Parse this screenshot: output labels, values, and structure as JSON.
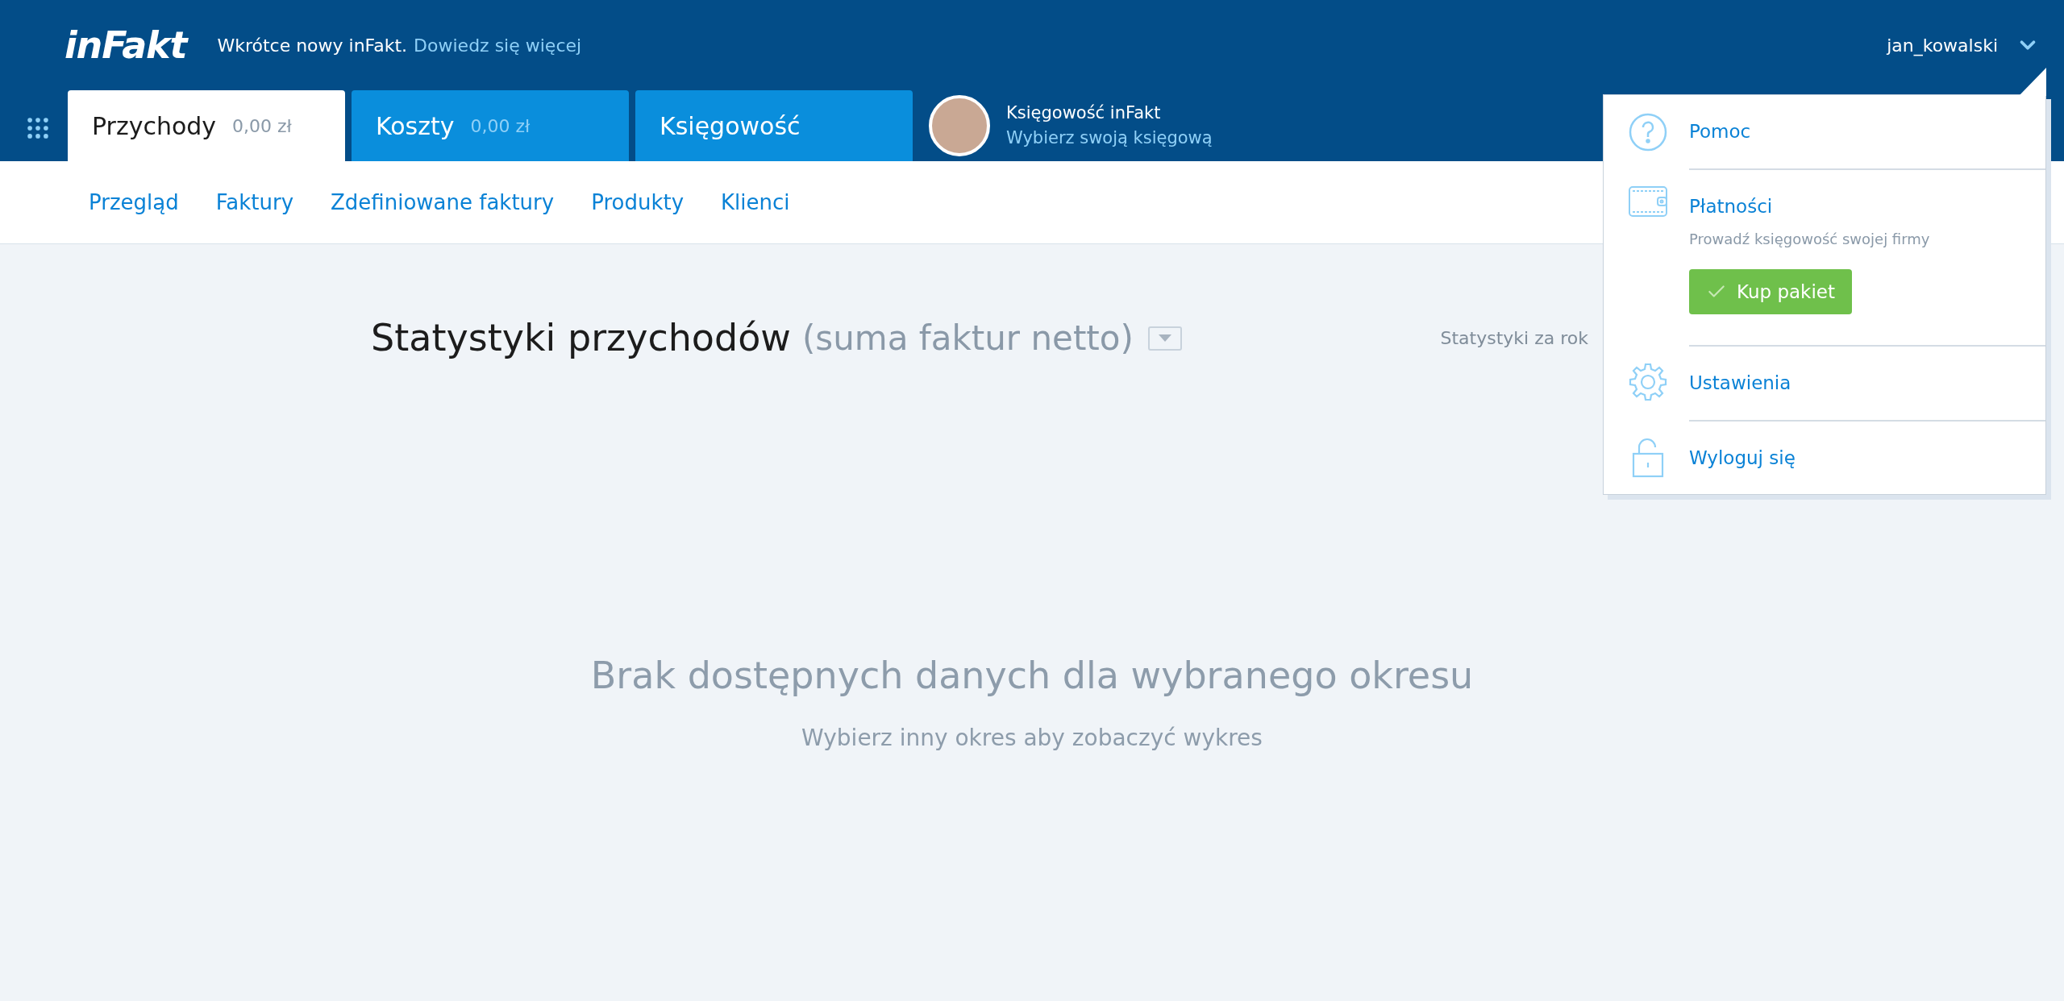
{
  "header": {
    "logo": "inFakt",
    "announcement": "Wkrótce nowy inFakt.",
    "announcement_link": "Dowiedz się więcej",
    "username": "jan_kowalski"
  },
  "tabs": [
    {
      "label": "Przychody",
      "amount": "0,00 zł",
      "selected": true
    },
    {
      "label": "Koszty",
      "amount": "0,00 zł",
      "selected": false
    },
    {
      "label": "Księgowość",
      "selected": false
    }
  ],
  "accountant": {
    "title": "Księgowość inFakt",
    "link": "Wybierz swoją księgową"
  },
  "subnav": [
    "Przegląd",
    "Faktury",
    "Zdefiniowane faktury",
    "Produkty",
    "Klienci"
  ],
  "stats": {
    "title": "Statystyki przychodów",
    "subtitle": "(suma faktur netto)",
    "period_label": "Statystyki za rok",
    "empty_title": "Brak dostępnych danych dla wybranego okresu",
    "empty_hint": "Wybierz inny okres aby zobaczyć wykres"
  },
  "menu": [
    {
      "kind": "help",
      "label": "Pomoc"
    },
    {
      "kind": "payment",
      "label": "Płatności",
      "description": "Prowadź księgowość swojej firmy",
      "button": "Kup pakiet"
    },
    {
      "kind": "settings",
      "label": "Ustawienia"
    },
    {
      "kind": "logout",
      "label": "Wyloguj się"
    }
  ]
}
